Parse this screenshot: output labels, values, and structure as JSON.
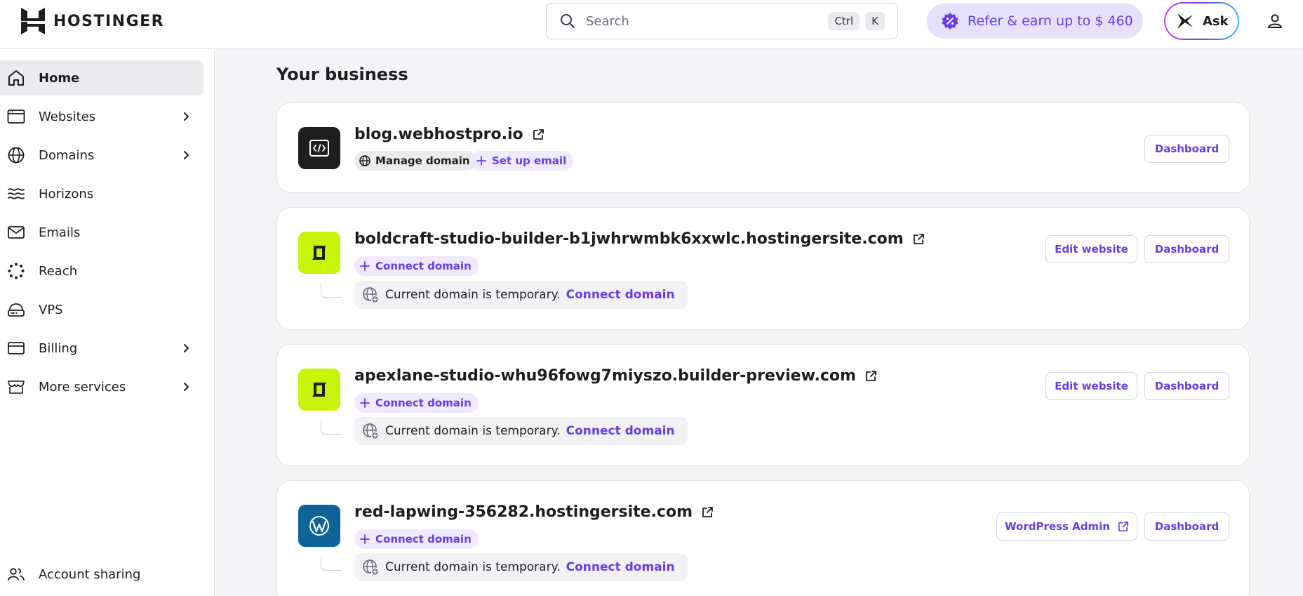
{
  "header": {
    "brand": "HOSTINGER",
    "search_placeholder": "Search",
    "shortcut_ctrl": "Ctrl",
    "shortcut_key": "K",
    "refer_label": "Refer & earn up to $ 460",
    "ask_label": "Ask"
  },
  "sidebar": {
    "items": [
      {
        "label": "Home",
        "icon": "home-icon",
        "active": true
      },
      {
        "label": "Websites",
        "icon": "websites-icon",
        "has_submenu": true
      },
      {
        "label": "Domains",
        "icon": "globe-icon",
        "has_submenu": true
      },
      {
        "label": "Horizons",
        "icon": "horizons-icon"
      },
      {
        "label": "Emails",
        "icon": "mail-icon"
      },
      {
        "label": "Reach",
        "icon": "reach-icon"
      },
      {
        "label": "VPS",
        "icon": "server-icon"
      },
      {
        "label": "Billing",
        "icon": "card-icon",
        "has_submenu": true
      },
      {
        "label": "More services",
        "icon": "store-icon",
        "has_submenu": true
      }
    ],
    "footer_item": {
      "label": "Account sharing",
      "icon": "users-icon"
    }
  },
  "main": {
    "title": "Your business",
    "cards": [
      {
        "domain": "blog.webhostpro.io",
        "icon": "code-icon",
        "manage_label": "Manage domain",
        "email_label": "Set up email",
        "dashboard_label": "Dashboard"
      },
      {
        "domain": "boldcraft-studio-builder-b1jwhrwmbk6xxwlc.hostingersite.com",
        "icon": "builder-logo-icon",
        "connect_label": "Connect domain",
        "temp_text": "Current domain is temporary.",
        "temp_link": "Connect domain",
        "edit_label": "Edit website",
        "dashboard_label": "Dashboard"
      },
      {
        "domain": "apexlane-studio-whu96fowg7miyszo.builder-preview.com",
        "icon": "builder-logo-icon",
        "connect_label": "Connect domain",
        "temp_text": "Current domain is temporary.",
        "temp_link": "Connect domain",
        "edit_label": "Edit website",
        "dashboard_label": "Dashboard"
      },
      {
        "domain": "red-lapwing-356282.hostingersite.com",
        "icon": "wordpress-icon",
        "connect_label": "Connect domain",
        "temp_text": "Current domain is temporary.",
        "temp_link": "Connect domain",
        "wp_admin_label": "WordPress Admin",
        "dashboard_label": "Dashboard"
      }
    ]
  },
  "colors": {
    "accent": "#673de6",
    "refer_bg": "#e6e1fb",
    "builder_icon_bg": "#c6f50a",
    "wordpress_icon_bg": "#0e6497"
  }
}
